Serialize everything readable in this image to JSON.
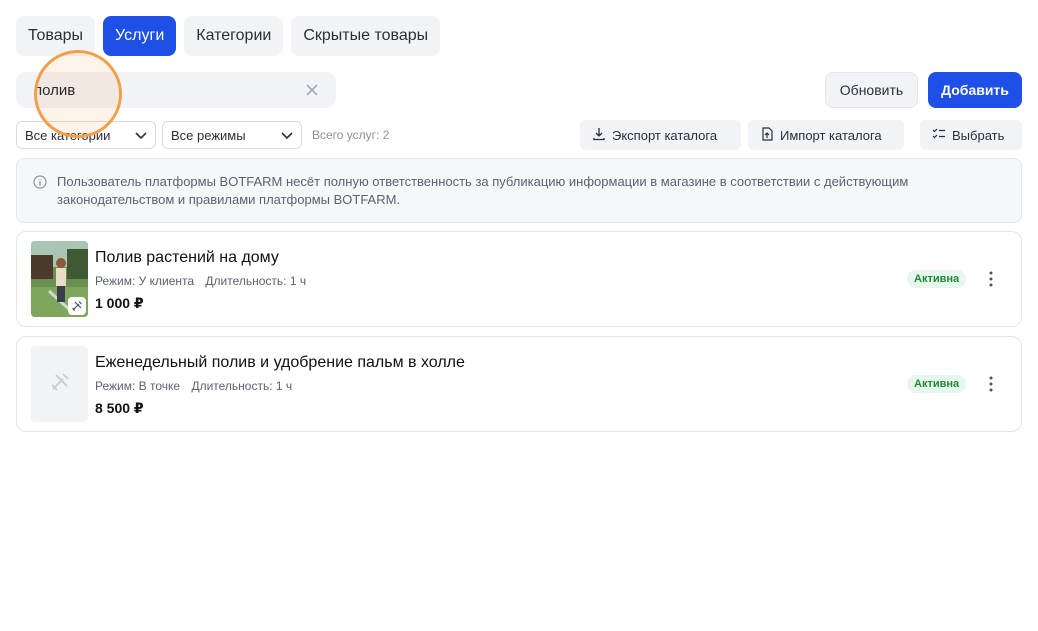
{
  "tabs": [
    {
      "label": "Товары",
      "active": false
    },
    {
      "label": "Услуги",
      "active": true
    },
    {
      "label": "Категории",
      "active": false
    },
    {
      "label": "Скрытые товары",
      "active": false
    }
  ],
  "search": {
    "value": "полив",
    "placeholder": ""
  },
  "toolbar": {
    "refresh_label": "Обновить",
    "add_label": "Добавить"
  },
  "filters": {
    "category_selected": "Все категории",
    "mode_selected": "Все режимы",
    "total_label": "Всего услуг: 2"
  },
  "actions": {
    "export_label": "Экспорт каталога",
    "import_label": "Импорт каталога",
    "select_label": "Выбрать"
  },
  "notice": {
    "text": "Пользователь платформы BOTFARM несёт полную ответственность за публикацию информации в магазине в соответствии с действующим законодательством и правилами платформы BOTFARM."
  },
  "services": [
    {
      "title": "Полив растений на дому",
      "mode": "Режим: У клиента",
      "duration": "Длительность: 1 ч",
      "price": "1 000 ₽",
      "status": "Активна"
    },
    {
      "title": "Еженедельный полив и удобрение пальм в холле",
      "mode": "Режим: В точке",
      "duration": "Длительность: 1 ч",
      "price": "8 500 ₽",
      "status": "Активна"
    }
  ],
  "colors": {
    "accent": "#1e4fe6",
    "status_green": "#1f8a3b",
    "cursor_ring": "#f0a04b"
  }
}
